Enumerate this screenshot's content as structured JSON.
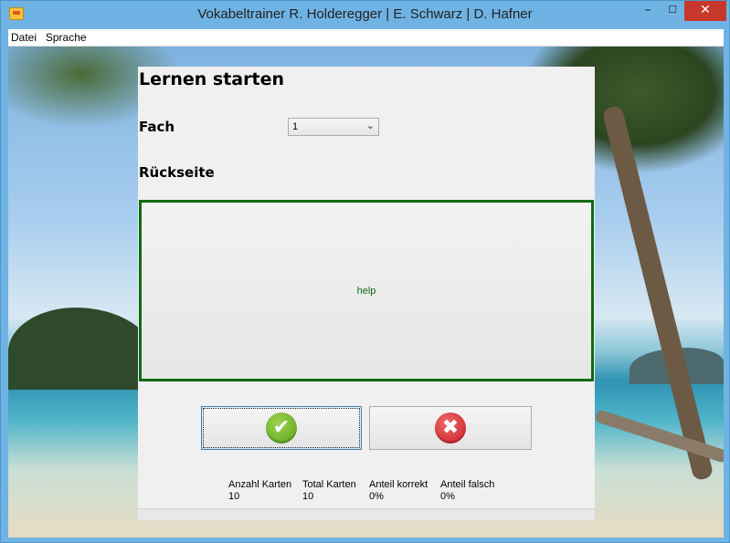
{
  "window": {
    "title": "Vokabeltrainer R. Holderegger | E. Schwarz | D. Hafner",
    "controls": {
      "minimize": "–",
      "maximize": "☐",
      "close": "✕"
    }
  },
  "menu": {
    "items": [
      "Datei",
      "Sprache"
    ]
  },
  "panel": {
    "title": "Lernen starten",
    "fach": {
      "label": "Fach",
      "selected": "1"
    },
    "rueckseite": {
      "label": "Rückseite",
      "text": "help"
    },
    "buttons": {
      "correct_icon": "✔",
      "wrong_icon": "✖"
    }
  },
  "stats": {
    "anzahl_karten": {
      "label": "Anzahl Karten",
      "value": "10"
    },
    "total_karten": {
      "label": "Total Karten",
      "value": "10"
    },
    "anteil_korrekt": {
      "label": "Anteil korrekt",
      "value": "0%"
    },
    "anteil_falsch": {
      "label": "Anteil falsch",
      "value": "0%"
    }
  }
}
